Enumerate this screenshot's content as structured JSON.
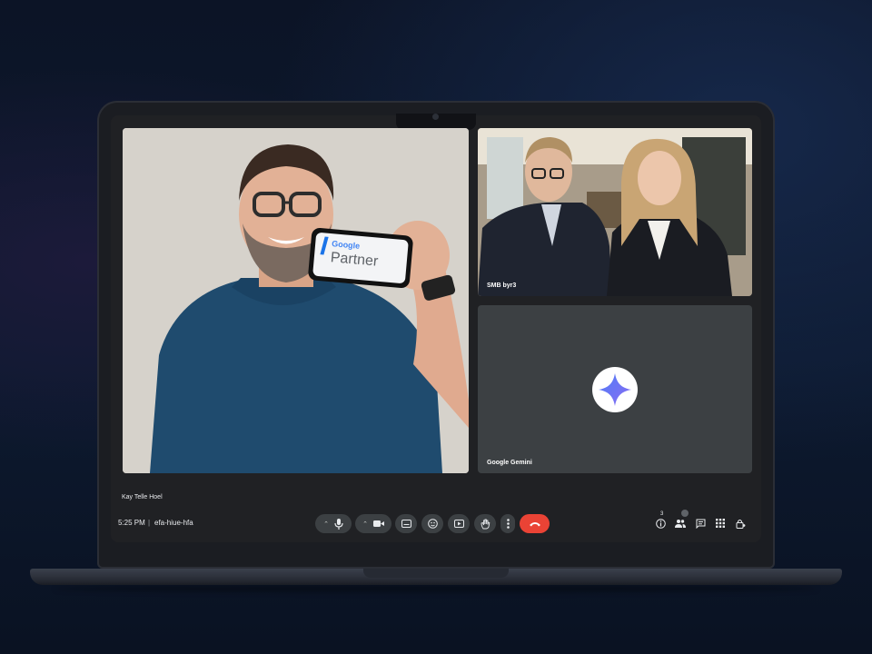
{
  "participants": {
    "main": {
      "name": "Kay Telle Hoel",
      "phone_logo_word": "Google",
      "phone_text": "Partner"
    },
    "top_right": {
      "name": "SMB byr3"
    },
    "gemini": {
      "name": "Google Gemini"
    }
  },
  "bottom_bar": {
    "time": "5:25 PM",
    "separator": "|",
    "meeting_code": "efa-hiue-hfa",
    "info_count": "3"
  },
  "controls": [
    {
      "name": "microphone",
      "icon": "mic-icon"
    },
    {
      "name": "camera",
      "icon": "camera-icon"
    },
    {
      "name": "captions",
      "icon": "captions-icon"
    },
    {
      "name": "reactions",
      "icon": "emoji-icon"
    },
    {
      "name": "present",
      "icon": "present-icon"
    },
    {
      "name": "raise-hand",
      "icon": "hand-icon"
    },
    {
      "name": "more-options",
      "icon": "more-vert-icon"
    },
    {
      "name": "leave-call",
      "icon": "call-end-icon"
    }
  ],
  "right_tools": [
    {
      "name": "meeting-info",
      "icon": "info-icon"
    },
    {
      "name": "people",
      "icon": "people-icon"
    },
    {
      "name": "chat",
      "icon": "chat-icon"
    },
    {
      "name": "activities",
      "icon": "apps-grid-icon"
    },
    {
      "name": "host-controls",
      "icon": "lock-person-icon"
    }
  ],
  "colors": {
    "end_call": "#ea4335",
    "control_bg": "#3c4043",
    "screen_bg": "#202124",
    "gemini_star_start": "#4f7cf7",
    "gemini_star_end": "#8a6cf2"
  }
}
